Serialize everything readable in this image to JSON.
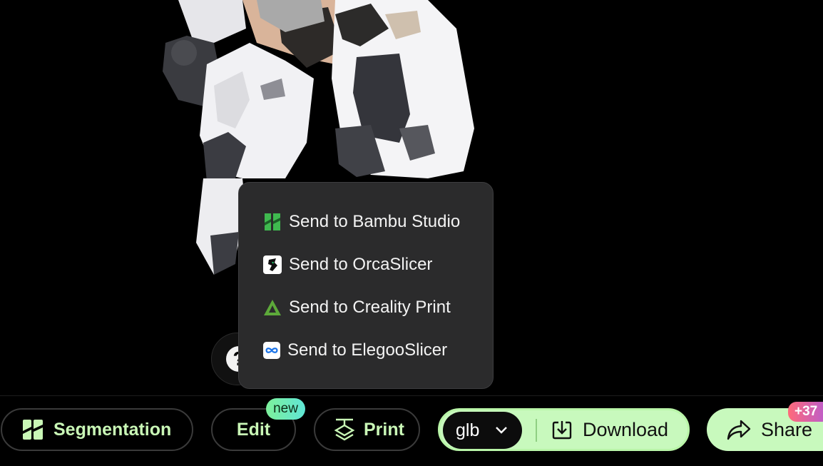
{
  "menu": {
    "items": [
      {
        "label": "Send to Bambu Studio",
        "icon": "bambu-studio-icon"
      },
      {
        "label": "Send to OrcaSlicer",
        "icon": "orcaslicer-icon"
      },
      {
        "label": "Send to Creality Print",
        "icon": "creality-print-icon"
      },
      {
        "label": "Send to ElegooSlicer",
        "icon": "elegooslicer-icon"
      }
    ]
  },
  "toolbar": {
    "segmentation_label": "Segmentation",
    "edit_label": "Edit",
    "new_badge": "new",
    "print_label": "Print",
    "format_value": "glb",
    "download_label": "Download",
    "share_label": "Share",
    "share_badge": "+37"
  },
  "colors": {
    "accent_green": "#c8f9bd",
    "popover_bg": "#2b2b2c",
    "label_green": "#c9f7b6"
  }
}
